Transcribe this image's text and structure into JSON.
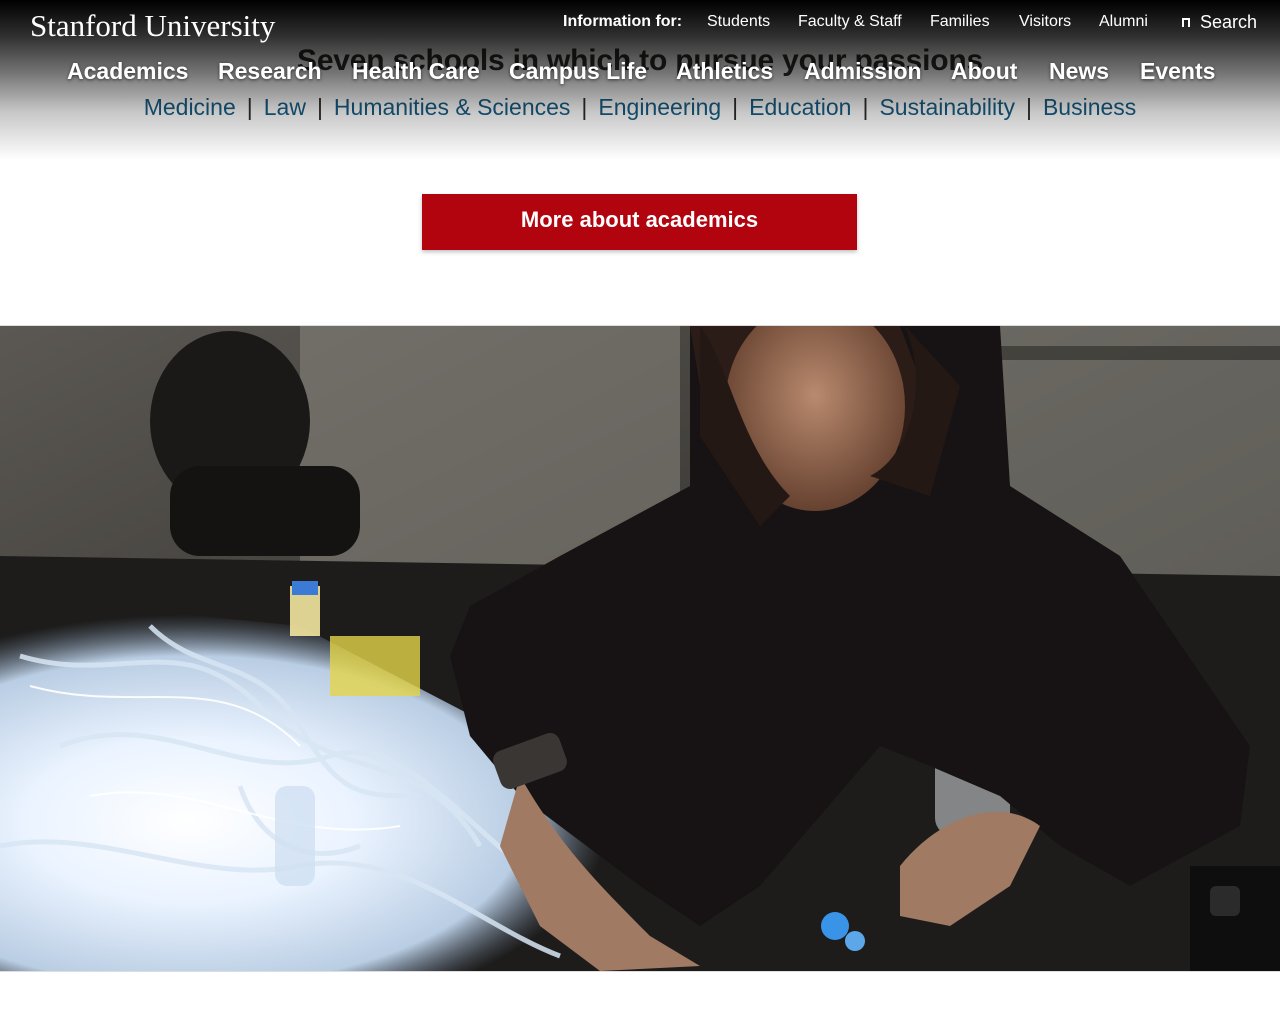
{
  "brand": {
    "name": "Stanford University"
  },
  "info_bar": {
    "label": "Information for:",
    "links": [
      "Students",
      "Faculty & Staff",
      "Families",
      "Visitors",
      "Alumni"
    ]
  },
  "search": {
    "label": "Search",
    "icon": "search-icon"
  },
  "main_nav": [
    "Academics",
    "Research",
    "Health Care",
    "Campus Life",
    "Athletics",
    "Admission",
    "About",
    "News",
    "Events"
  ],
  "academics": {
    "heading": "Seven schools in which to pursue your passions",
    "schools": [
      "Medicine",
      "Law",
      "Humanities & Sciences",
      "Engineering",
      "Education",
      "Sustainability",
      "Business"
    ],
    "separator": "|",
    "cta_label": "More about academics"
  },
  "colors": {
    "cardinal": "#b1040e",
    "link": "#175e85",
    "text": "#2e2d29"
  }
}
